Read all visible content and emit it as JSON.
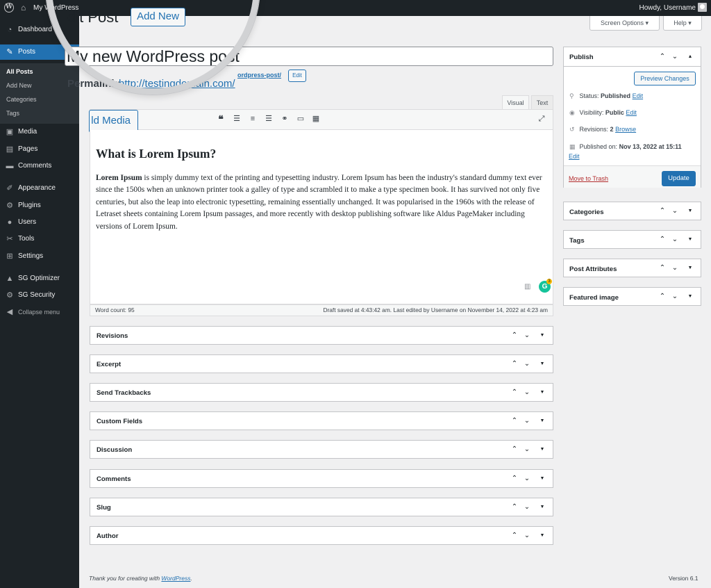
{
  "admin_bar": {
    "site_name": "My WordPress",
    "howdy": "Howdy, Username"
  },
  "sidebar": {
    "items": [
      {
        "label": "Dashboard",
        "icon": "dashboard-icon"
      },
      {
        "label": "Posts",
        "icon": "pin-icon"
      },
      {
        "label": "Media",
        "icon": "media-icon"
      },
      {
        "label": "Pages",
        "icon": "pages-icon"
      },
      {
        "label": "Comments",
        "icon": "comments-icon"
      },
      {
        "label": "Appearance",
        "icon": "brush-icon"
      },
      {
        "label": "Plugins",
        "icon": "plugin-icon"
      },
      {
        "label": "Users",
        "icon": "users-icon"
      },
      {
        "label": "Tools",
        "icon": "wrench-icon"
      },
      {
        "label": "Settings",
        "icon": "settings-icon"
      },
      {
        "label": "SG Optimizer",
        "icon": "sg-optimizer-icon"
      },
      {
        "label": "SG Security",
        "icon": "sg-security-icon"
      },
      {
        "label": "Collapse menu",
        "icon": "collapse-icon"
      }
    ],
    "submenu": [
      "All Posts",
      "Add New",
      "Categories",
      "Tags"
    ]
  },
  "screen_options": "Screen Options",
  "help": "Help",
  "page_title": "dit Post",
  "add_new": "Add New",
  "post_title": "My new WordPress post",
  "permalink": {
    "label": "Permalink:",
    "url": "http://testingdomain.com/",
    "tail": "ordpress-post/",
    "edit": "Edit"
  },
  "add_media": "ld Media",
  "editor": {
    "tab_visual": "Visual",
    "tab_text": "Text",
    "heading": "What is Lorem Ipsum?",
    "body_bold": "Lorem Ipsum",
    "body": " is simply dummy text of the printing and typesetting industry. Lorem Ipsum has been the industry's standard dummy text ever since the 1500s when an unknown printer took a galley of type and scrambled it to make a type specimen book. It has survived not only five centuries, but also the leap into electronic typesetting, remaining essentially unchanged. It was popularised in the 1960s with the release of Letraset sheets containing Lorem Ipsum passages, and more recently with desktop publishing software like Aldus PageMaker including versions of Lorem Ipsum.",
    "word_count": "Word count: 95",
    "draft_saved": "Draft saved at 4:43:42 am. Last edited by Username on November 14, 2022 at 4:23 am",
    "grammarly_badge": "3"
  },
  "metaboxes": [
    "Revisions",
    "Excerpt",
    "Send Trackbacks",
    "Custom Fields",
    "Discussion",
    "Comments",
    "Slug",
    "Author"
  ],
  "publish": {
    "title": "Publish",
    "preview": "Preview Changes",
    "status_label": "Status:",
    "status_value": "Published",
    "visibility_label": "Visibility:",
    "visibility_value": "Public",
    "revisions_label": "Revisions:",
    "revisions_value": "2",
    "browse": "Browse",
    "published_label": "Published on:",
    "published_value": "Nov 13, 2022 at 15:11",
    "edit": "Edit",
    "trash": "Move to Trash",
    "update": "Update"
  },
  "side_boxes": [
    "Categories",
    "Tags",
    "Post Attributes",
    "Featured image"
  ],
  "footer": {
    "thanks_prefix": "Thank you for creating with ",
    "wordpress_link": "WordPress",
    "thanks_suffix": ".",
    "version": "Version 6.1"
  },
  "colors": {
    "admin_dark": "#1d2327",
    "accent_blue": "#2271b1",
    "trash_red": "#b32d2e",
    "page_bg": "#f0f0f1"
  }
}
